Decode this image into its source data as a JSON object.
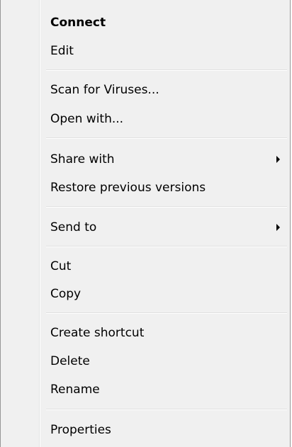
{
  "menu": {
    "items": [
      {
        "label": "Connect"
      },
      {
        "label": "Edit"
      },
      {
        "label": "Scan for Viruses..."
      },
      {
        "label": "Open with..."
      },
      {
        "label": "Share with"
      },
      {
        "label": "Restore previous versions"
      },
      {
        "label": "Send to"
      },
      {
        "label": "Cut"
      },
      {
        "label": "Copy"
      },
      {
        "label": "Create shortcut"
      },
      {
        "label": "Delete"
      },
      {
        "label": "Rename"
      },
      {
        "label": "Properties"
      }
    ],
    "submenu_arrow_icon": "chevron-right-icon"
  }
}
